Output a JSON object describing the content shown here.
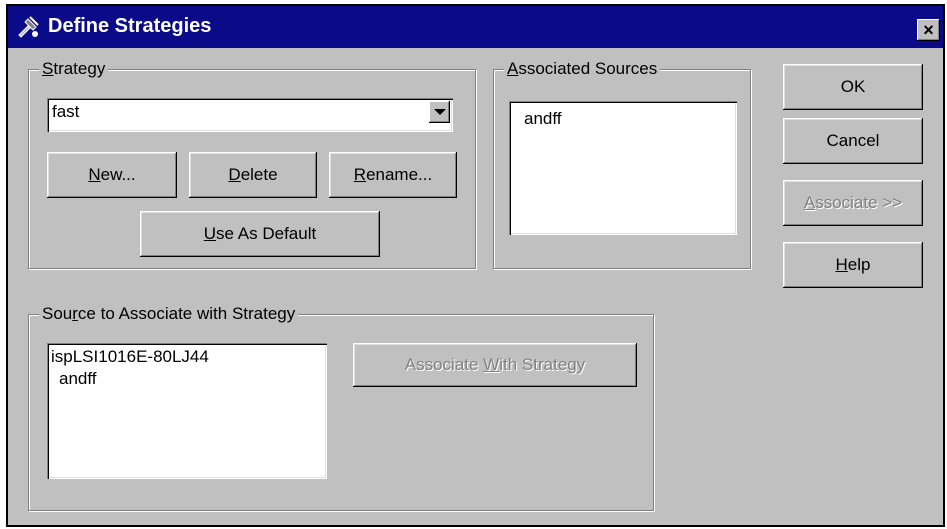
{
  "window": {
    "title": "Define Strategies",
    "close_glyph": "×"
  },
  "strategy": {
    "group_label": "Strategy",
    "group_label_mnemonic": "S",
    "selected_value": "fast",
    "new_label": "New...",
    "new_mnemonic": "N",
    "delete_label": "Delete",
    "delete_mnemonic": "D",
    "rename_label": "Rename...",
    "rename_mnemonic": "R",
    "default_label": "Use As Default",
    "default_mnemonic": "U"
  },
  "associated_sources": {
    "group_label": "Associated Sources",
    "group_label_mnemonic": "A",
    "items": [
      "andff"
    ]
  },
  "buttons": {
    "ok_label": "OK",
    "cancel_label": "Cancel",
    "associate_label": "Associate >>",
    "associate_mnemonic": "A",
    "help_label": "Help",
    "help_mnemonic": "H"
  },
  "source_to_associate": {
    "group_label": "Source to Associate with Strategy",
    "group_label_mnemonic": "r",
    "items": [
      "ispLSI1016E-80LJ44",
      "andff"
    ],
    "associate_with_label": "Associate With Strategy",
    "associate_with_mnemonic": "W"
  },
  "colors": {
    "titlebar": "#0b0b8a",
    "face": "#c0c0c0"
  },
  "icons": {
    "title": "strategy-app-icon"
  }
}
